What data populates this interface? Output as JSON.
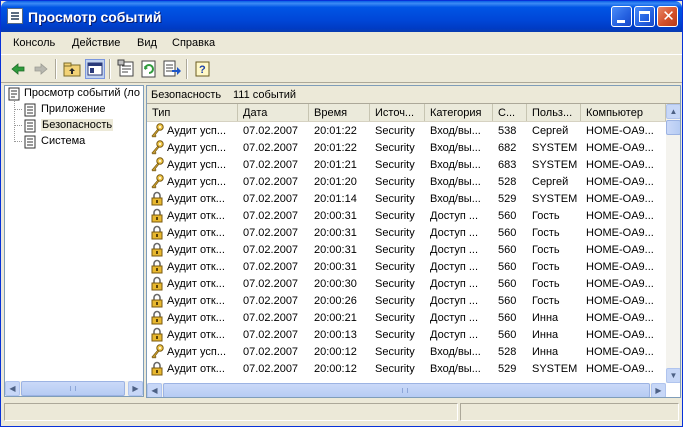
{
  "window": {
    "title": "Просмотр событий"
  },
  "menu": [
    "Консоль",
    "Действие",
    "Вид",
    "Справка"
  ],
  "toolbar": {
    "icons": [
      "back-arrow-icon",
      "forward-arrow-icon",
      "up-folder-icon",
      "show-hide-tree-icon",
      "properties-icon",
      "refresh-icon",
      "export-list-icon",
      "help-icon"
    ]
  },
  "tree": {
    "root": "Просмотр событий (ло",
    "items": [
      "Приложение",
      "Безопасность",
      "Система"
    ],
    "selected": "Безопасность"
  },
  "panel": {
    "name": "Безопасность",
    "count": "111 событий"
  },
  "columns": [
    "Тип",
    "Дата",
    "Время",
    "Источ...",
    "Категория",
    "С...",
    "Польз...",
    "Компьютер"
  ],
  "events": [
    {
      "icon": "key-icon",
      "type": "Аудит усп...",
      "date": "07.02.2007",
      "time": "20:01:22",
      "source": "Security",
      "category": "Вход/вы...",
      "id": "538",
      "user": "Сергей",
      "computer": "HOME-OA9..."
    },
    {
      "icon": "key-icon",
      "type": "Аудит усп...",
      "date": "07.02.2007",
      "time": "20:01:22",
      "source": "Security",
      "category": "Вход/вы...",
      "id": "682",
      "user": "SYSTEM",
      "computer": "HOME-OA9..."
    },
    {
      "icon": "key-icon",
      "type": "Аудит усп...",
      "date": "07.02.2007",
      "time": "20:01:21",
      "source": "Security",
      "category": "Вход/вы...",
      "id": "683",
      "user": "SYSTEM",
      "computer": "HOME-OA9..."
    },
    {
      "icon": "key-icon",
      "type": "Аудит усп...",
      "date": "07.02.2007",
      "time": "20:01:20",
      "source": "Security",
      "category": "Вход/вы...",
      "id": "528",
      "user": "Сергей",
      "computer": "HOME-OA9..."
    },
    {
      "icon": "lock-icon",
      "type": "Аудит отк...",
      "date": "07.02.2007",
      "time": "20:01:14",
      "source": "Security",
      "category": "Вход/вы...",
      "id": "529",
      "user": "SYSTEM",
      "computer": "HOME-OA9..."
    },
    {
      "icon": "lock-icon",
      "type": "Аудит отк...",
      "date": "07.02.2007",
      "time": "20:00:31",
      "source": "Security",
      "category": "Доступ ...",
      "id": "560",
      "user": "Гость",
      "computer": "HOME-OA9..."
    },
    {
      "icon": "lock-icon",
      "type": "Аудит отк...",
      "date": "07.02.2007",
      "time": "20:00:31",
      "source": "Security",
      "category": "Доступ ...",
      "id": "560",
      "user": "Гость",
      "computer": "HOME-OA9..."
    },
    {
      "icon": "lock-icon",
      "type": "Аудит отк...",
      "date": "07.02.2007",
      "time": "20:00:31",
      "source": "Security",
      "category": "Доступ ...",
      "id": "560",
      "user": "Гость",
      "computer": "HOME-OA9..."
    },
    {
      "icon": "lock-icon",
      "type": "Аудит отк...",
      "date": "07.02.2007",
      "time": "20:00:31",
      "source": "Security",
      "category": "Доступ ...",
      "id": "560",
      "user": "Гость",
      "computer": "HOME-OA9..."
    },
    {
      "icon": "lock-icon",
      "type": "Аудит отк...",
      "date": "07.02.2007",
      "time": "20:00:30",
      "source": "Security",
      "category": "Доступ ...",
      "id": "560",
      "user": "Гость",
      "computer": "HOME-OA9..."
    },
    {
      "icon": "lock-icon",
      "type": "Аудит отк...",
      "date": "07.02.2007",
      "time": "20:00:26",
      "source": "Security",
      "category": "Доступ ...",
      "id": "560",
      "user": "Гость",
      "computer": "HOME-OA9..."
    },
    {
      "icon": "lock-icon",
      "type": "Аудит отк...",
      "date": "07.02.2007",
      "time": "20:00:21",
      "source": "Security",
      "category": "Доступ ...",
      "id": "560",
      "user": "Инна",
      "computer": "HOME-OA9..."
    },
    {
      "icon": "lock-icon",
      "type": "Аудит отк...",
      "date": "07.02.2007",
      "time": "20:00:13",
      "source": "Security",
      "category": "Доступ ...",
      "id": "560",
      "user": "Инна",
      "computer": "HOME-OA9..."
    },
    {
      "icon": "key-icon",
      "type": "Аудит усп...",
      "date": "07.02.2007",
      "time": "20:00:12",
      "source": "Security",
      "category": "Вход/вы...",
      "id": "528",
      "user": "Инна",
      "computer": "HOME-OA9..."
    },
    {
      "icon": "lock-icon",
      "type": "Аудит отк...",
      "date": "07.02.2007",
      "time": "20:00:12",
      "source": "Security",
      "category": "Вход/вы...",
      "id": "529",
      "user": "SYSTEM",
      "computer": "HOME-OA9..."
    }
  ]
}
